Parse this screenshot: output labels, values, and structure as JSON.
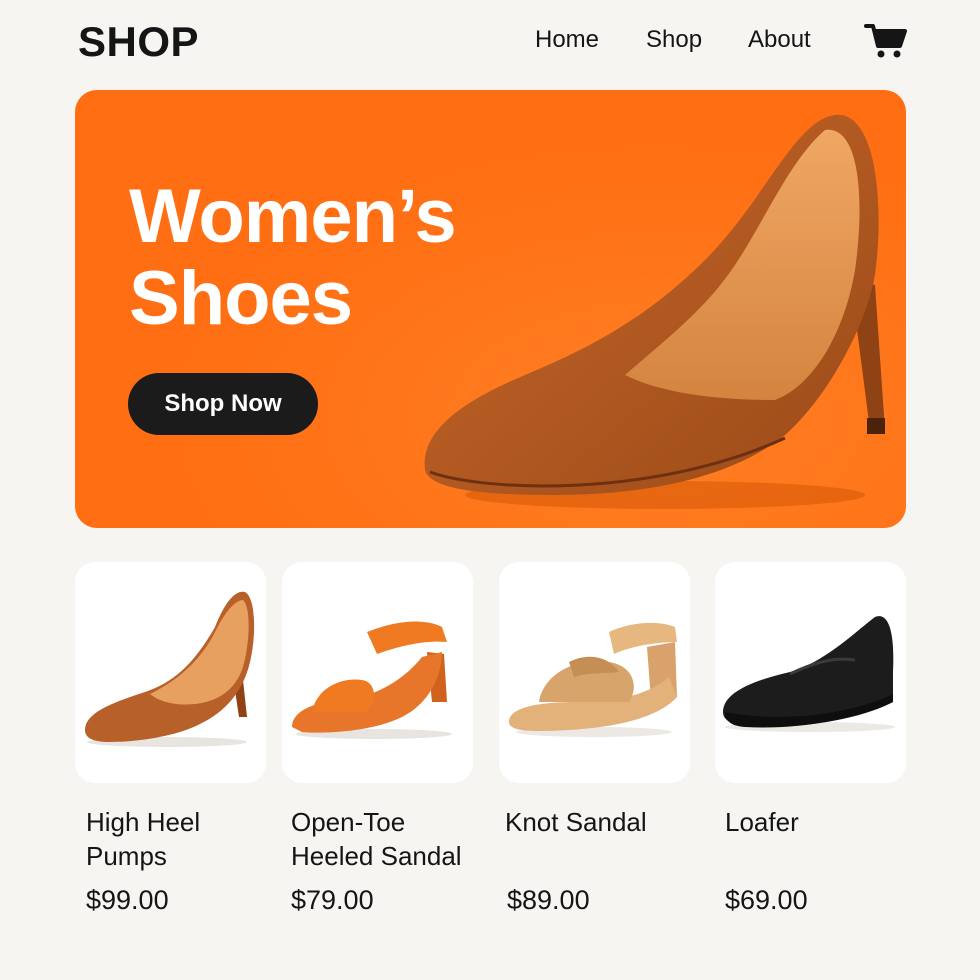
{
  "header": {
    "logo": "SHOP",
    "nav": [
      "Home",
      "Shop",
      "About"
    ],
    "cart_icon": "shopping-cart-icon"
  },
  "hero": {
    "title_line1": "Women’s",
    "title_line2": "Shoes",
    "cta": "Shop Now",
    "background": "#ff6e12"
  },
  "products": [
    {
      "name_line1": "High Heel",
      "name_line2": "Pumps",
      "price": "$99.00",
      "image": "high-heel-pump"
    },
    {
      "name_line1": "Open-Toe",
      "name_line2": "Heeled Sandal",
      "price": "$79.00",
      "image": "open-toe-sandal"
    },
    {
      "name_line1": "Knot Sandal",
      "name_line2": "",
      "price": "$89.00",
      "image": "knot-sandal"
    },
    {
      "name_line1": "Loafer",
      "name_line2": "",
      "price": "$69.00",
      "image": "loafer"
    }
  ]
}
